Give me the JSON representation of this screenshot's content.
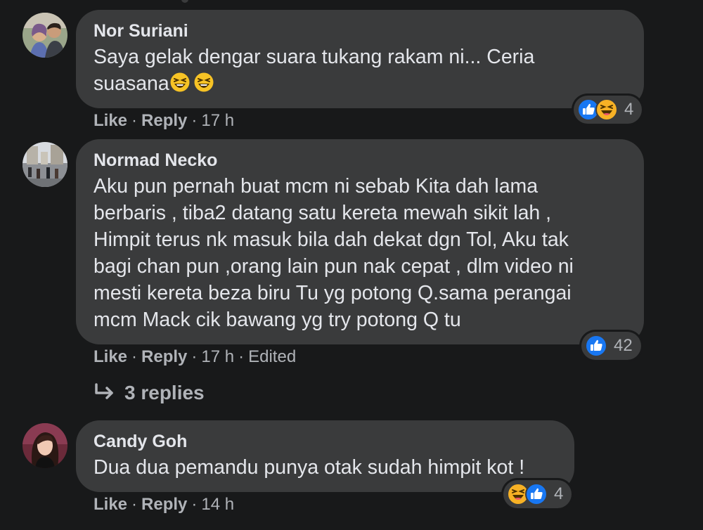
{
  "comments": [
    {
      "author": "Nor Suriani",
      "text": "Saya gelak dengar suara tukang rakam ni... Ceria suasana",
      "text_line1": "Saya gelak dengar suara tukang rakam ni... Ceria",
      "text_line2": "suasana",
      "like_label": "Like",
      "reply_label": "Reply",
      "time": "17 h",
      "reaction_icons": [
        "like-reaction",
        "haha-reaction"
      ],
      "reaction_count": "4"
    },
    {
      "author": "Normad Necko",
      "text": "Aku pun pernah buat mcm ni sebab Kita dah lama\nberbaris , tiba2 datang satu kereta mewah sikit lah ,\nHimpit terus nk masuk bila dah dekat dgn Tol, Aku tak\nbagi chan pun ,orang lain pun nak cepat , dlm video ni\nmesti kereta beza biru Tu yg potong Q.sama perangai\nmcm Mack cik bawang yg try potong Q tu",
      "like_label": "Like",
      "reply_label": "Reply",
      "time": "17 h",
      "edited_label": "Edited",
      "reaction_icons": [
        "like-reaction"
      ],
      "reaction_count": "42",
      "replies_label": "3 replies"
    },
    {
      "author": "Candy Goh",
      "text": "Dua dua pemandu punya otak sudah himpit kot !",
      "like_label": "Like",
      "reply_label": "Reply",
      "time": "14 h",
      "reaction_icons": [
        "haha-reaction",
        "like-reaction"
      ],
      "reaction_count": "4"
    }
  ],
  "separator": "·",
  "colors": {
    "background": "#18191a",
    "bubble": "#3a3b3c",
    "primary_text": "#e4e6eb",
    "secondary_text": "#b0b3b8",
    "like_blue": "#1877f2",
    "haha_yellow": "#f7b125"
  }
}
